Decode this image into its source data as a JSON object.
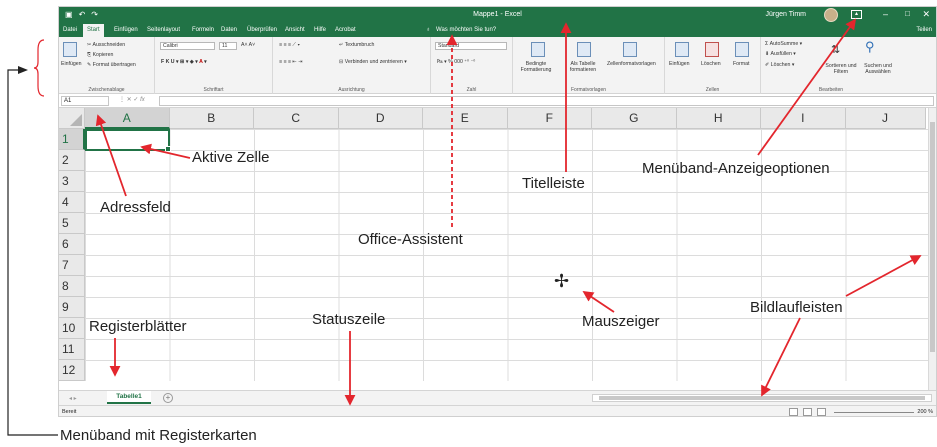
{
  "window": {
    "title": "Mappe1 - Excel",
    "user": "Jürgen Timm",
    "colors": {
      "excel_green": "#217346",
      "annotation_red": "#e3262d"
    }
  },
  "tabs": [
    "Datei",
    "Start",
    "Einfügen",
    "Seitenlayout",
    "Formeln",
    "Daten",
    "Überprüfen",
    "Ansicht",
    "Hilfe",
    "Acrobat"
  ],
  "tell_me": "Was möchten Sie tun?",
  "share": "Teilen",
  "ribbon": {
    "clipboard": {
      "paste": "Einfügen",
      "cut": "Ausschneiden",
      "copy": "Kopieren",
      "format_painter": "Format übertragen",
      "label": "Zwischenablage"
    },
    "font": {
      "name": "Calibri",
      "size": "11",
      "label": "Schriftart"
    },
    "alignment": {
      "wrap": "Textumbruch",
      "merge": "Verbinden und zentrieren",
      "label": "Ausrichtung"
    },
    "number": {
      "format": "Standard",
      "label": "Zahl"
    },
    "styles": {
      "conditional": "Bedingte Formatierung",
      "as_table": "Als Tabelle formatieren",
      "cell_styles": "Zellenformatvorlagen",
      "label": "Formatvorlagen"
    },
    "cells": {
      "insert": "Einfügen",
      "delete": "Löschen",
      "format": "Format",
      "label": "Zellen"
    },
    "editing": {
      "autosum": "AutoSumme",
      "fill": "Ausfüllen",
      "clear": "Löschen",
      "sort": "Sortieren und Filtern",
      "find": "Suchen und Auswählen",
      "label": "Bearbeiten"
    }
  },
  "formula_bar": {
    "name_box": "A1",
    "fx": "fx"
  },
  "columns": [
    "A",
    "B",
    "C",
    "D",
    "E",
    "F",
    "G",
    "H",
    "I",
    "J"
  ],
  "rows": [
    "1",
    "2",
    "3",
    "4",
    "5",
    "6",
    "7",
    "8",
    "9",
    "10",
    "11",
    "12"
  ],
  "sheet_tab": "Tabelle1",
  "status": {
    "ready": "Bereit",
    "zoom": "200 %"
  },
  "annotations": {
    "active_cell": "Aktive Zelle",
    "title_bar": "Titelleiste",
    "ribbon_display": "Menüband-Anzeigeoptionen",
    "name_box": "Adressfeld",
    "office_assistant": "Office-Assistent",
    "sheet_tabs": "Registerblätter",
    "status_bar": "Statuszeile",
    "mouse_pointer": "Mauszeiger",
    "scrollbars": "Bildlaufleisten",
    "ribbon_tabs": "Menüband mit Registerkarten"
  }
}
